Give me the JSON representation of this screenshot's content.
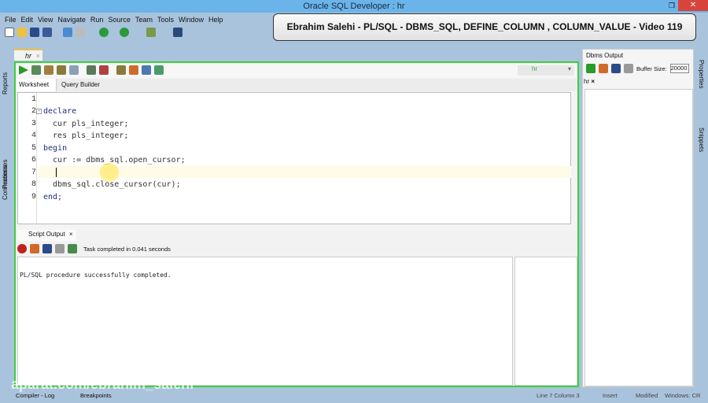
{
  "window": {
    "title": "Oracle SQL Developer : hr",
    "close": "✕",
    "restore": "❐"
  },
  "menu": [
    "File",
    "Edit",
    "View",
    "Navigate",
    "Run",
    "Source",
    "Team",
    "Tools",
    "Window",
    "Help"
  ],
  "banner": "Ebrahim Salehi - PL/SQL - DBMS_SQL, DEFINE_COLUMN , COLUMN_VALUE - Video 119",
  "left_sidebar": [
    "Reports",
    "Processes",
    "Connections"
  ],
  "right_sidebar": [
    "Properties",
    "Snippets"
  ],
  "document_tab": {
    "label": "hr",
    "close": "×"
  },
  "connection": "hr",
  "worksheet_tabs": [
    "Worksheet",
    "Query Builder"
  ],
  "code": {
    "line_numbers": [
      "1",
      "2",
      "3",
      "4",
      "5",
      "6",
      "7",
      "8",
      "9"
    ],
    "lines": [
      "",
      "declare",
      "  cur pls_integer;",
      "  res pls_integer;",
      "begin",
      "  cur := dbms_sql.open_cursor;",
      "  ",
      "  dbms_sql.close_cursor(cur);",
      "end;"
    ]
  },
  "script_output": {
    "tab": "Script Output",
    "close": "×",
    "status": "Task completed in 0.041 seconds",
    "text": "PL/SQL procedure successfully completed."
  },
  "dbms_output": {
    "title": "Dbms Output",
    "buffer_label": "Buffer Size:",
    "buffer_value": "20000",
    "sub_tab": "hr",
    "sub_close": "×"
  },
  "status_bar": {
    "tabs": [
      "Compiler - Log",
      "Breakpoints"
    ],
    "position": "Line 7 Column 3",
    "mode": "Insert",
    "modified": "Modified",
    "eol": "Windows: CR"
  },
  "watermark": "aparat.com/ebrahim_salehi"
}
